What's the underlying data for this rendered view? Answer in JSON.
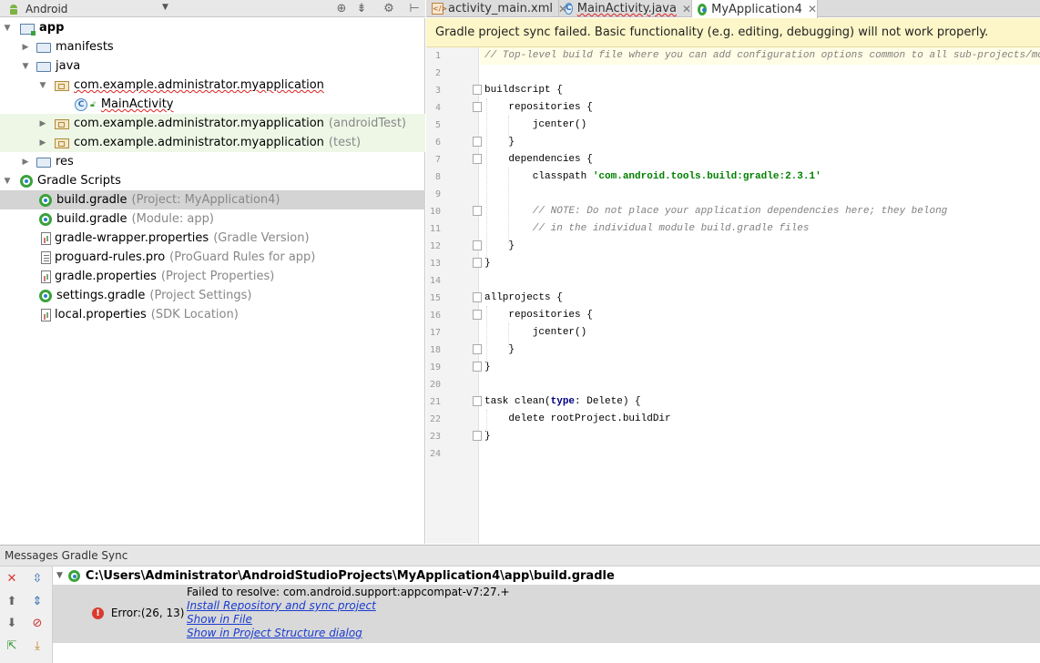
{
  "project_panel": {
    "view_mode": "Android",
    "toolbar_icons": [
      "target-icon",
      "collapse-icon",
      "gear-icon",
      "hide-icon"
    ],
    "tree": [
      {
        "label": "app",
        "icon": "module-icon",
        "expanded": true
      },
      {
        "label": "manifests",
        "icon": "folder-icon",
        "expanded": false
      },
      {
        "label": "java",
        "icon": "folder-icon",
        "expanded": true
      },
      {
        "label": "com.example.administrator.myapplication",
        "icon": "package-icon",
        "expanded": true
      },
      {
        "label": "MainActivity",
        "icon": "class-icon"
      },
      {
        "label": "com.example.administrator.myapplication",
        "suffix": "(androidTest)",
        "icon": "package-icon",
        "expanded": false
      },
      {
        "label": "com.example.administrator.myapplication",
        "suffix": "(test)",
        "icon": "package-icon",
        "expanded": false
      },
      {
        "label": "res",
        "icon": "folder-icon",
        "expanded": false
      },
      {
        "label": "Gradle Scripts",
        "icon": "gradle-icon",
        "expanded": true
      },
      {
        "label": "build.gradle",
        "suffix": "(Project: MyApplication4)",
        "icon": "gradle-icon",
        "selected": true
      },
      {
        "label": "build.gradle",
        "suffix": "(Module: app)",
        "icon": "gradle-icon"
      },
      {
        "label": "gradle-wrapper.properties",
        "suffix": "(Gradle Version)",
        "icon": "properties-icon"
      },
      {
        "label": "proguard-rules.pro",
        "suffix": "(ProGuard Rules for app)",
        "icon": "file-icon"
      },
      {
        "label": "gradle.properties",
        "suffix": "(Project Properties)",
        "icon": "properties-icon"
      },
      {
        "label": "settings.gradle",
        "suffix": "(Project Settings)",
        "icon": "gradle-icon"
      },
      {
        "label": "local.properties",
        "suffix": "(SDK Location)",
        "icon": "properties-icon"
      }
    ]
  },
  "editor": {
    "tabs": [
      {
        "label": "activity_main.xml",
        "icon": "xml-icon",
        "active": false
      },
      {
        "label": "MainActivity.java",
        "icon": "class-icon",
        "active": false
      },
      {
        "label": "MyApplication4",
        "icon": "gradle-icon",
        "active": true
      }
    ],
    "banner": "Gradle project sync failed. Basic functionality (e.g. editing, debugging) will not work properly.",
    "lines": [
      {
        "n": "1",
        "text": "// Top-level build file where you can add configuration options common to all sub-projects/modules."
      },
      {
        "n": "2",
        "text": ""
      },
      {
        "n": "3",
        "text": "buildscript {"
      },
      {
        "n": "4",
        "text": "    repositories {"
      },
      {
        "n": "5",
        "text": "        jcenter()"
      },
      {
        "n": "6",
        "text": "    }"
      },
      {
        "n": "7",
        "text": "    dependencies {"
      },
      {
        "n": "8",
        "text": "        classpath 'com.android.tools.build:gradle:2.3.1'"
      },
      {
        "n": "9",
        "text": ""
      },
      {
        "n": "10",
        "text": "        // NOTE: Do not place your application dependencies here; they belong"
      },
      {
        "n": "11",
        "text": "        // in the individual module build.gradle files"
      },
      {
        "n": "12",
        "text": "    }"
      },
      {
        "n": "13",
        "text": "}"
      },
      {
        "n": "14",
        "text": ""
      },
      {
        "n": "15",
        "text": "allprojects {"
      },
      {
        "n": "16",
        "text": "    repositories {"
      },
      {
        "n": "17",
        "text": "        jcenter()"
      },
      {
        "n": "18",
        "text": "    }"
      },
      {
        "n": "19",
        "text": "}"
      },
      {
        "n": "20",
        "text": ""
      },
      {
        "n": "21",
        "text": "task clean(type: Delete) {"
      },
      {
        "n": "22",
        "text": "    delete rootProject.buildDir"
      },
      {
        "n": "23",
        "text": "}"
      },
      {
        "n": "24",
        "text": ""
      }
    ]
  },
  "messages": {
    "title": "Messages Gradle Sync",
    "path": "C:\\Users\\Administrator\\AndroidStudioProjects\\MyApplication4\\app\\build.gradle",
    "error_label": "Error:(26, 13)",
    "error_text": "Failed to resolve: com.android.support:appcompat-v7:27.+",
    "links": [
      "Install Repository and sync project",
      "Show in File",
      "Show in Project Structure dialog"
    ],
    "side_icons": [
      "close-icon",
      "expand-all-icon",
      "up-icon",
      "collapse-all-icon",
      "down-icon",
      "stop-icon",
      "export-icon",
      "download-icon"
    ]
  },
  "colors": {
    "selection": "#d4d4d4",
    "test_bg": "#eef7e6",
    "banner_bg": "#fdf6c9",
    "error": "#d93a2f",
    "link": "#1a3bd0",
    "string": "#008000",
    "comment": "#808080"
  }
}
